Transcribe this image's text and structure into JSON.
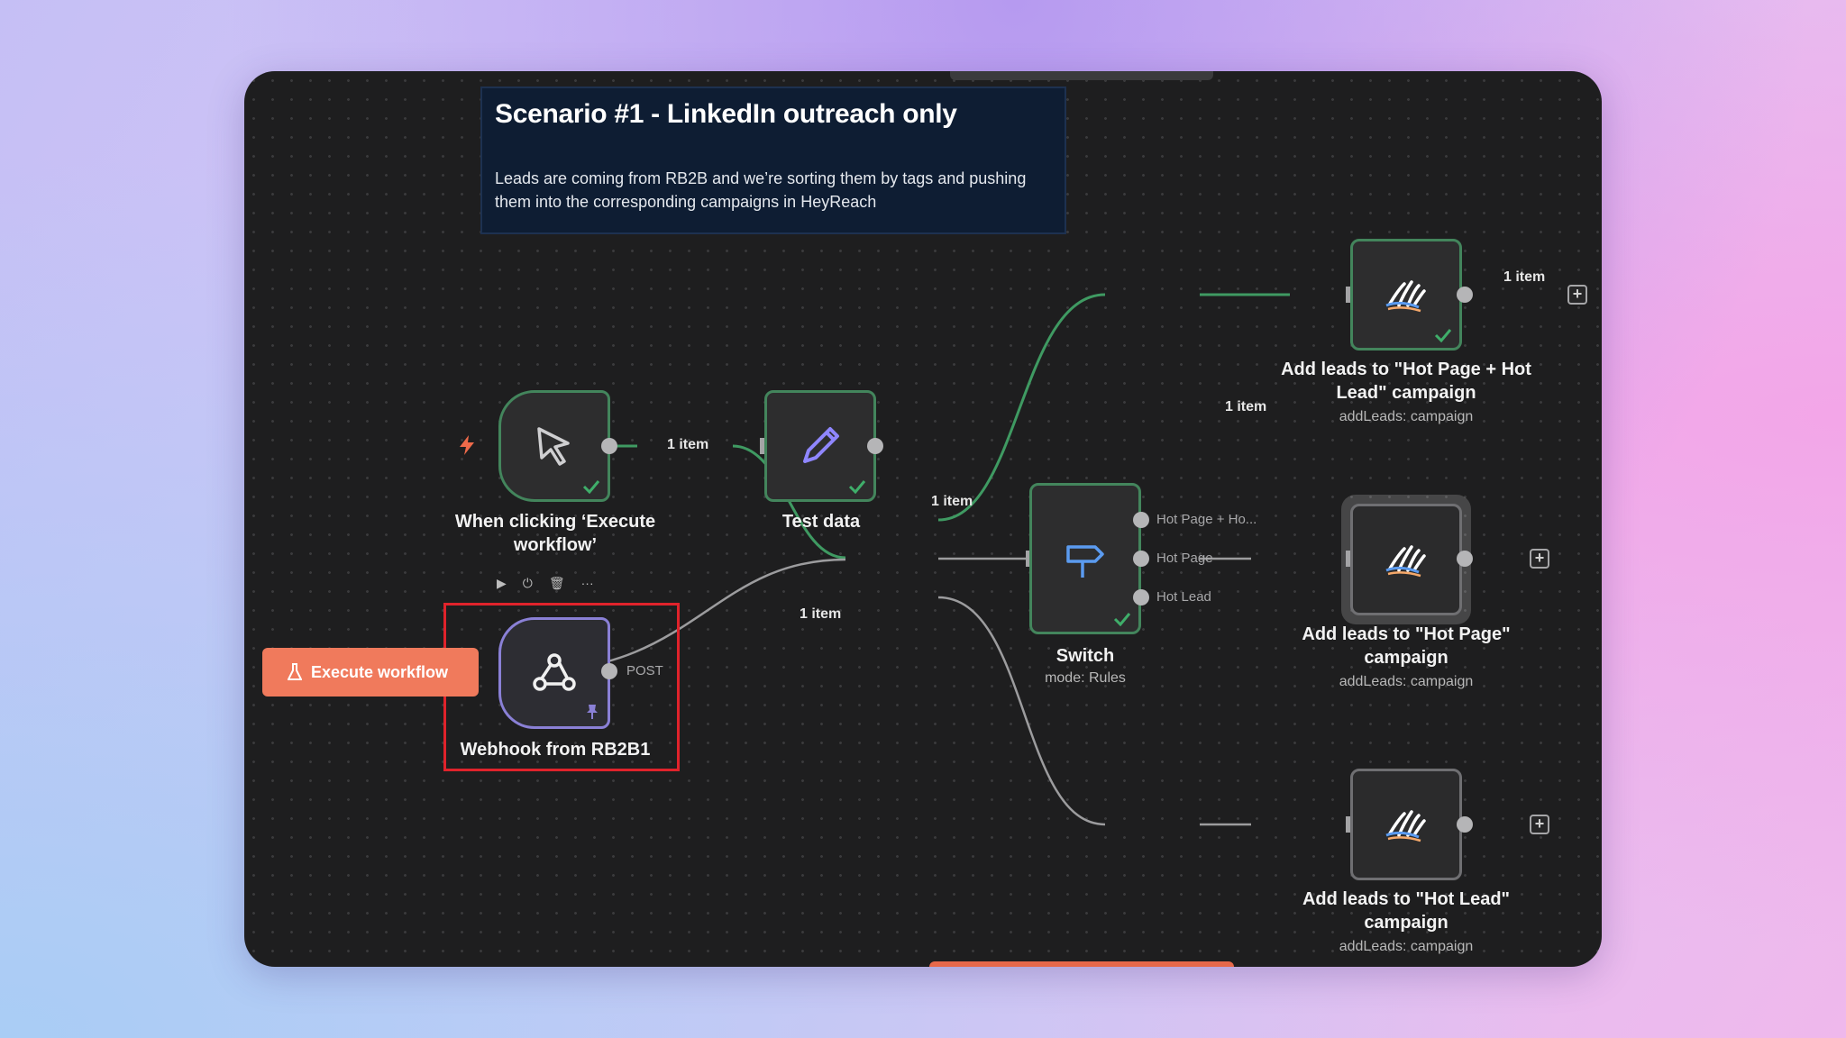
{
  "note": {
    "title": "Scenario #1 - LinkedIn outreach only",
    "body": "Leads are coming from RB2B and we’re sorting them by tags and pushing them into the corresponding campaigns in HeyReach"
  },
  "nodes": {
    "trigger": {
      "label": "When clicking ‘Execute workflow’",
      "icon": "cursor-arrow-icon"
    },
    "test_data": {
      "label": "Test data",
      "icon": "pencil-icon"
    },
    "webhook": {
      "label": "Webhook from RB2B1",
      "icon": "webhook-icon",
      "output": "POST"
    },
    "switch": {
      "label": "Switch",
      "subtitle": "mode: Rules",
      "icon": "signpost-icon",
      "outputs": [
        "Hot Page + Ho...",
        "Hot Page",
        "Hot Lead"
      ]
    },
    "heyreach_1": {
      "label": "Add leads to \"Hot Page + Hot Lead\" campaign",
      "subtitle": "addLeads: campaign",
      "icon": "heyreach-hand-icon"
    },
    "heyreach_2": {
      "label": "Add leads to \"Hot Page\" campaign",
      "subtitle": "addLeads: campaign",
      "icon": "heyreach-hand-icon"
    },
    "heyreach_3": {
      "label": "Add leads to \"Hot Lead\" campaign",
      "subtitle": "addLeads: campaign",
      "icon": "heyreach-hand-icon"
    }
  },
  "edges": {
    "trigger_to_test": "1 item",
    "test_to_switch": "1 item",
    "webhook_to_switch": "1 item",
    "switch_to_hr1": "1 item",
    "hr1_out": "1 item"
  },
  "buttons": {
    "execute_workflow": "Execute workflow"
  },
  "colors": {
    "success_edge": "#3f9a62",
    "execute_button": "#f07a5c",
    "selection": "#e0232b"
  }
}
